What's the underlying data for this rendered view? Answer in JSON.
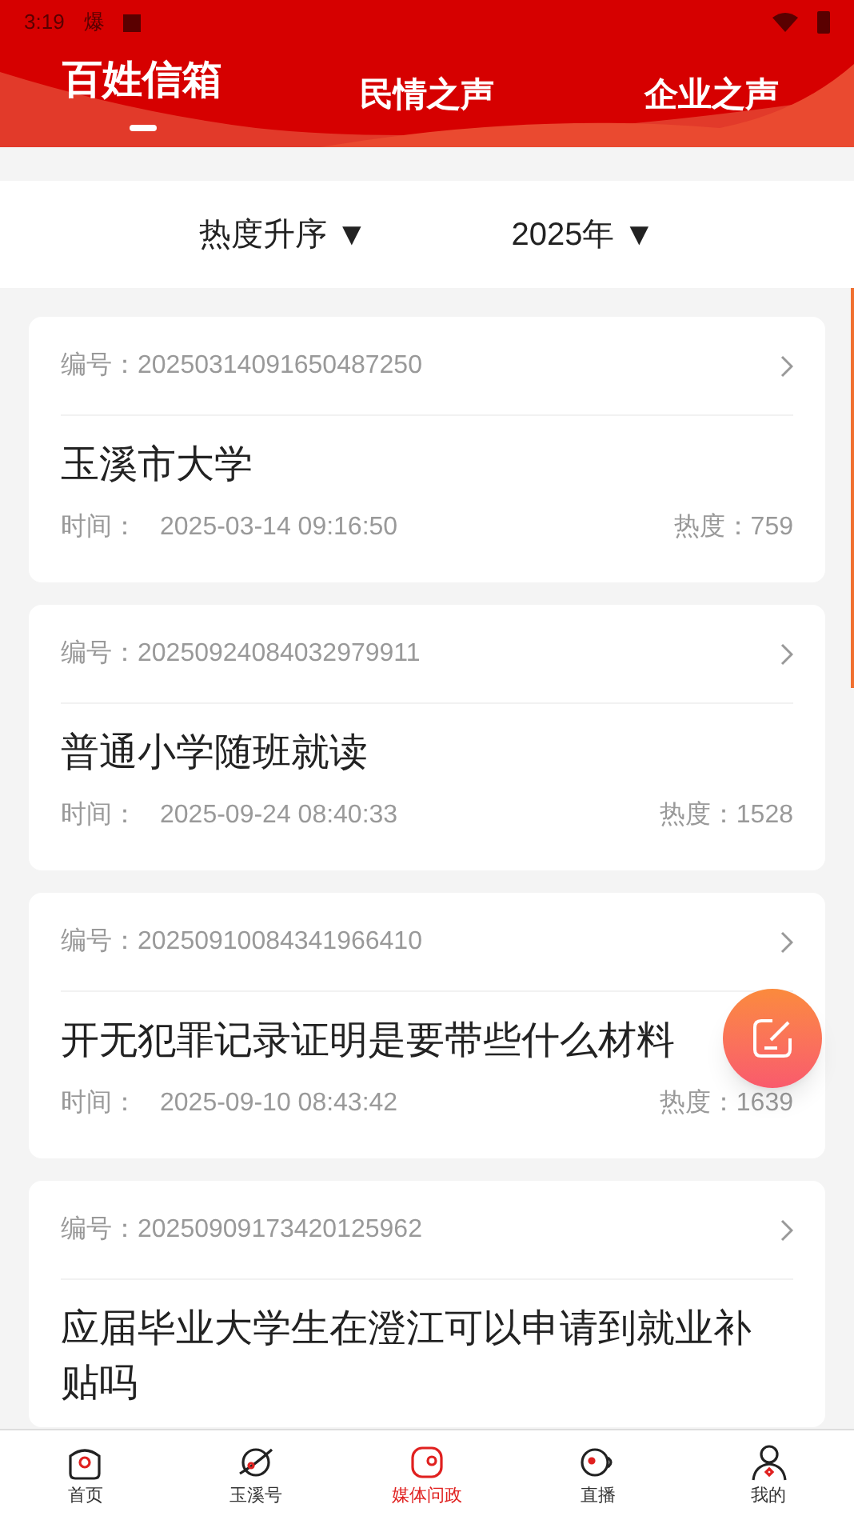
{
  "status_bar": {
    "time": "3:19",
    "notification": "爆"
  },
  "tabs": [
    {
      "label": "百姓信箱",
      "selected": true
    },
    {
      "label": "民情之声",
      "selected": false
    },
    {
      "label": "企业之声",
      "selected": false
    }
  ],
  "filters": [
    {
      "label": "热度升序 ▼"
    },
    {
      "label": "2025年 ▼"
    }
  ],
  "letters": [
    {
      "number": "编号：20250314091650487250",
      "title": "玉溪市大学",
      "time_label": "时间：",
      "time": "2025-03-14 09:16:50",
      "heat": "热度：759"
    },
    {
      "number": "编号：20250924084032979911",
      "title": "普通小学随班就读",
      "time_label": "时间：",
      "time": "2025-09-24 08:40:33",
      "heat": "热度：1528"
    },
    {
      "number": "编号：20250910084341966410",
      "title": "开无犯罪记录证明是要带些什么材料",
      "time_label": "时间：",
      "time": "2025-09-10 08:43:42",
      "heat": "热度：1639"
    },
    {
      "number": "编号：20250909173420125962",
      "title": "应届毕业大学生在澄江可以申请到就业补贴吗"
    }
  ],
  "bottom_nav": [
    {
      "label": "首页",
      "selected": false
    },
    {
      "label": "玉溪号",
      "selected": false
    },
    {
      "label": "媒体问政",
      "selected": true
    },
    {
      "label": "直播",
      "selected": false
    },
    {
      "label": "我的",
      "selected": false
    }
  ]
}
